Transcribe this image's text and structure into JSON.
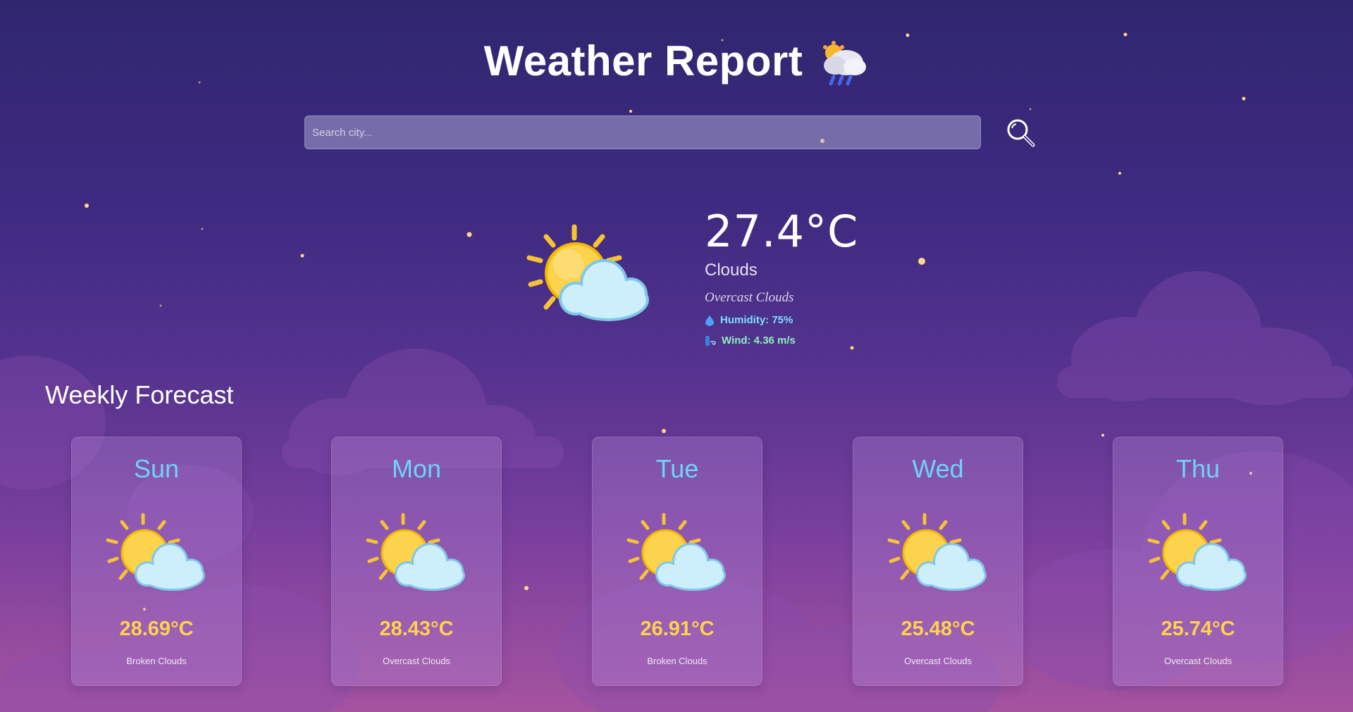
{
  "header": {
    "title": "Weather Report",
    "title_icon": "cloud-rain-sun-icon"
  },
  "search": {
    "placeholder": "Search city...",
    "value": "",
    "button_icon": "search-icon"
  },
  "current": {
    "icon": "sun-behind-cloud-icon",
    "temperature": "27.4°C",
    "condition": "Clouds",
    "description": "Overcast Clouds",
    "humidity": "Humidity: 75%",
    "wind": "Wind: 4.36 m/s"
  },
  "forecast": {
    "heading": "Weekly Forecast",
    "days": [
      {
        "day": "Sun",
        "temp": "28.69°C",
        "desc": "Broken Clouds",
        "icon": "sun-behind-cloud-icon"
      },
      {
        "day": "Mon",
        "temp": "28.43°C",
        "desc": "Overcast Clouds",
        "icon": "sun-behind-cloud-icon"
      },
      {
        "day": "Tue",
        "temp": "26.91°C",
        "desc": "Broken Clouds",
        "icon": "sun-behind-cloud-icon"
      },
      {
        "day": "Wed",
        "temp": "25.48°C",
        "desc": "Overcast Clouds",
        "icon": "sun-behind-cloud-icon"
      },
      {
        "day": "Thu",
        "temp": "25.74°C",
        "desc": "Overcast Clouds",
        "icon": "sun-behind-cloud-icon"
      }
    ]
  },
  "colors": {
    "background_top": "#30266f",
    "background_bottom": "#a5539f",
    "day_label": "#6fd3f7",
    "forecast_temp": "#ffd24d",
    "humidity": "#7fdfff",
    "wind": "#8ff0c0"
  }
}
